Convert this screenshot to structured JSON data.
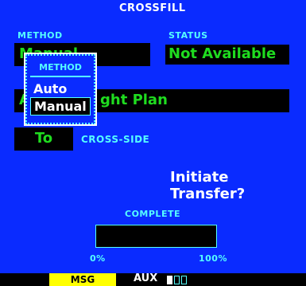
{
  "header": {
    "title": "CROSSFILL"
  },
  "method": {
    "label": "METHOD",
    "value": "Manual"
  },
  "status": {
    "label": "STATUS",
    "value": "Not Available"
  },
  "flight_plan": {
    "value": "Active Flight Plan",
    "visible_suffix": "ght Plan",
    "visible_prefix": "A"
  },
  "direction": {
    "value": "To",
    "suffix_label": "CROSS-SIDE"
  },
  "transfer": {
    "prompt": "Initiate Transfer?"
  },
  "progress": {
    "label": "COMPLETE",
    "min_label": "0%",
    "max_label": "100%",
    "value_percent": 0
  },
  "popup": {
    "title": "METHOD",
    "options": [
      {
        "label": "Auto",
        "selected": false
      },
      {
        "label": "Manual",
        "selected": true
      }
    ]
  },
  "footer": {
    "msg": "MSG",
    "aux": "AUX"
  },
  "colors": {
    "bg": "#0a2bff",
    "field": "#000000",
    "value": "#1fdc1f",
    "label": "#55ffff",
    "msg": "#ffff00"
  }
}
